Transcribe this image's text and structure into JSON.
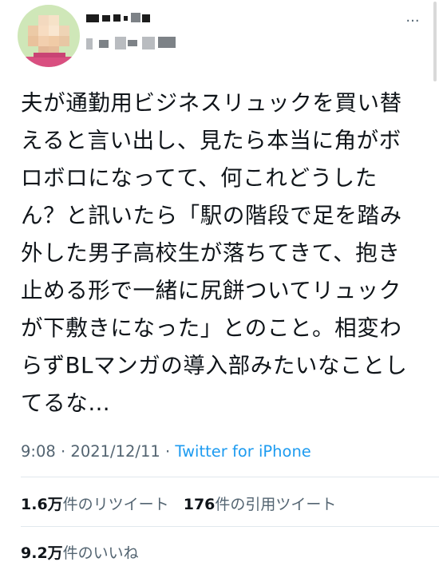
{
  "tweet": {
    "text": "夫が通勤用ビジネスリュックを買い替えると言い出し、見たら本当に角がボロボロになってて、何これどうしたん？と訊いたら「駅の階段で足を踏み外した男子高校生が落ちてきて、抱き止める形で一緒に尻餅ついてリュックが下敷きになった」とのこと。相変わらずBLマンガの導入部みたいなことしてるな…",
    "time": "9:08",
    "separator1": " · ",
    "date": "2021/12/11",
    "separator2": " · ",
    "source": "Twitter for iPhone"
  },
  "stats": {
    "retweets_count": "1.6万",
    "retweets_label": "件のリツイート",
    "quotes_count": "176",
    "quotes_label": "件の引用ツイート",
    "likes_count": "9.2万",
    "likes_label": "件のいいね"
  },
  "header": {
    "more_icon": "more-horizontal-icon"
  },
  "colors": {
    "text": "#0f1419",
    "secondary": "#536471",
    "link": "#1d9bf0",
    "divider": "#e1e8ed"
  }
}
